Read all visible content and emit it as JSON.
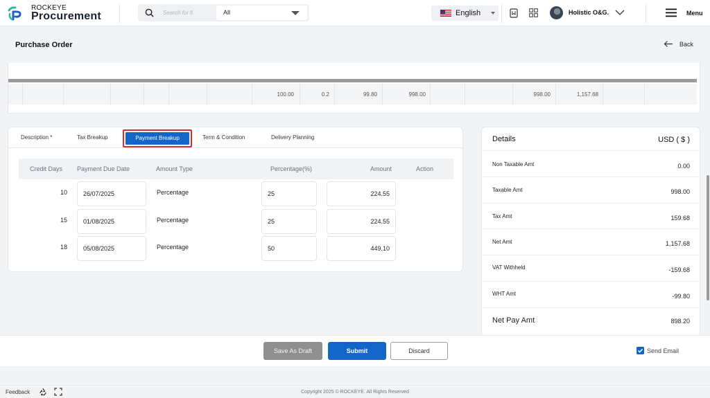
{
  "header": {
    "brand_small": "ROCKEYE",
    "brand_big": "Procurement",
    "search_placeholder": "Search for fi",
    "search_filter": "All",
    "language": "English",
    "user_name": "Holistic O&G.",
    "menu_label": "Menu"
  },
  "page": {
    "title": "Purchase Order",
    "back_label": "Back"
  },
  "line_items": {
    "row": [
      "100.00",
      "0.2",
      "99.80",
      "998.00",
      "998.00",
      "1,157.68"
    ]
  },
  "tabs": {
    "description": "Description *",
    "tax": "Tax Breakup",
    "payment": "Payment Breakup",
    "terms": "Term & Condition",
    "delivery": "Delivery Planning"
  },
  "payment_table": {
    "headers": {
      "credit_days": "Credit Days",
      "due_date": "Payment Due Date",
      "amount_type": "Amount Type",
      "percentage": "Percentage(%)",
      "amount": "Amount",
      "action": "Action"
    },
    "rows": [
      {
        "credit_days": "10",
        "due_date": "26/07/2025",
        "amount_type": "Percentage",
        "percentage": "25",
        "amount": "224.55"
      },
      {
        "credit_days": "15",
        "due_date": "01/08/2025",
        "amount_type": "Percentage",
        "percentage": "25",
        "amount": "224.55"
      },
      {
        "credit_days": "18",
        "due_date": "05/08/2025",
        "amount_type": "Percentage",
        "percentage": "50",
        "amount": "449.10"
      }
    ]
  },
  "details": {
    "title": "Details",
    "currency": "USD ( $ )",
    "rows": [
      {
        "label": "Non Taxable Amt",
        "value": "0.00"
      },
      {
        "label": "Taxable Amt",
        "value": "998.00"
      },
      {
        "label": "Tax Amt",
        "value": "159.68"
      },
      {
        "label": "Net Amt",
        "value": "1,157.68"
      },
      {
        "label": "VAT Withheld",
        "value": "-159.68"
      },
      {
        "label": "WHT Amt",
        "value": "-99.80"
      },
      {
        "label": "Net Pay Amt",
        "value": "898.20"
      }
    ]
  },
  "actions": {
    "save_draft": "Save As Draft",
    "submit": "Submit",
    "discard": "Discard",
    "send_email": "Send Email"
  },
  "footer": {
    "feedback": "Feedback",
    "copyright": "Copyright 2025 © ROCKEYE. All Rights Reserved"
  },
  "colors": {
    "primary": "#1266c9",
    "highlight_border": "#e0262f",
    "disabled_button": "#8f8f8f"
  }
}
